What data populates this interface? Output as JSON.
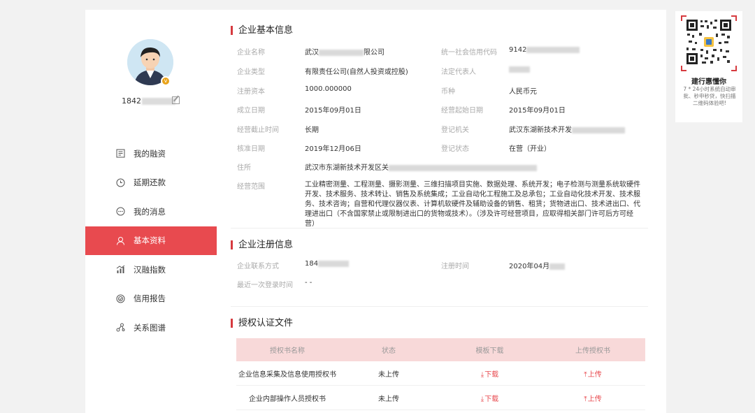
{
  "profile": {
    "phone_prefix": "1842"
  },
  "nav": [
    {
      "label": "我的融资",
      "icon": "finance-icon"
    },
    {
      "label": "延期还款",
      "icon": "clock-icon"
    },
    {
      "label": "我的消息",
      "icon": "message-icon"
    },
    {
      "label": "基本资料",
      "icon": "user-icon",
      "active": true
    },
    {
      "label": "汉融指数",
      "icon": "chart-icon"
    },
    {
      "label": "信用报告",
      "icon": "report-icon"
    },
    {
      "label": "关系图谱",
      "icon": "graph-icon"
    }
  ],
  "basic_info": {
    "title": "企业基本信息",
    "rows": [
      {
        "l1": "企业名称",
        "v1a": "武汉",
        "v1b": "限公司",
        "l2": "统一社会信用代码",
        "v2": "9142"
      },
      {
        "l1": "企业类型",
        "v1": "有限责任公司(自然人投资或控股)",
        "l2": "法定代表人",
        "v2": ""
      },
      {
        "l1": "注册资本",
        "v1": "1000.000000",
        "l2": "币种",
        "v2": "人民币元"
      },
      {
        "l1": "成立日期",
        "v1": "2015年09月01日",
        "l2": "经营起始日期",
        "v2": "2015年09月01日"
      },
      {
        "l1": "经营截止时间",
        "v1": "长期",
        "l2": "登记机关",
        "v2": "武汉东湖新技术开发"
      },
      {
        "l1": "核准日期",
        "v1": "2019年12月06日",
        "l2": "登记状态",
        "v2": "在营（开业）"
      }
    ],
    "address_label": "住所",
    "address_value": "武汉市东湖新技术开发区关",
    "scope_label": "经营范围",
    "scope_value": "工业精密测量、工程测量、摄影测量、三维扫描项目实施、数据处理、系统开发；电子检测与测量系统软硬件开发、技术服务、技术转让、销售及系统集成；工业自动化工程施工及总承包；工业自动化技术开发、技术服务、技术咨询；自营和代理仪器仪表、计算机软硬件及辅助设备的销售、租赁；货物进出口、技术进出口、代理进出口（不含国家禁止或限制进出口的货物或技术）。（涉及许可经营项目，应取得相关部门许可后方可经营）"
  },
  "reg_info": {
    "title": "企业注册信息",
    "contact_label": "企业联系方式",
    "contact_value": "184",
    "regtime_label": "注册时间",
    "regtime_value": "2020年04月",
    "lastlogin_label": "最近一次登录时间",
    "lastlogin_value": "- -"
  },
  "auth_files": {
    "title": "授权认证文件",
    "headers": [
      "授权书名称",
      "状态",
      "模板下载",
      "上传授权书"
    ],
    "rows": [
      {
        "name": "企业信息采集及信息使用授权书",
        "status": "未上传",
        "download": "下载",
        "upload": "上传"
      },
      {
        "name": "企业内部操作人员授权书",
        "status": "未上传",
        "download": "下载",
        "upload": "上传"
      }
    ]
  },
  "qr_card": {
    "title": "建行惠懂你",
    "desc": "7 * 24小时系统自动审批、秒申秒贷，快扫描二维码体验吧!"
  },
  "colors": {
    "accent": "#e84a4f",
    "table_head": "#f8d9d9"
  }
}
